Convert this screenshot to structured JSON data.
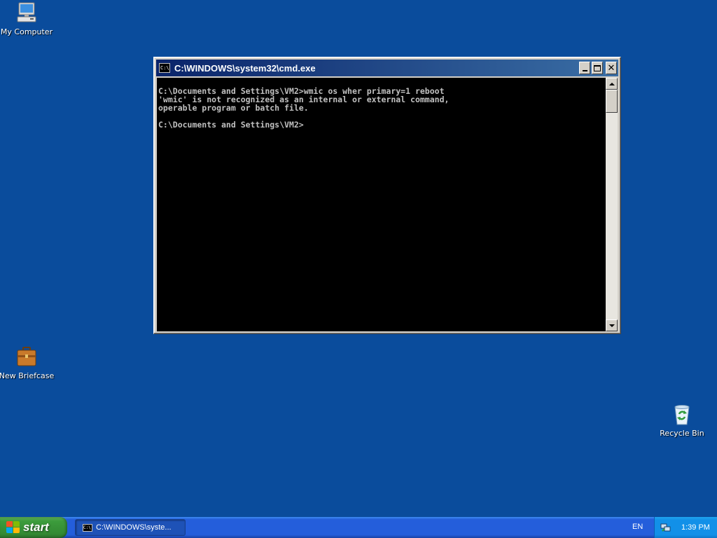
{
  "desktop": {
    "icons": [
      {
        "label": "My Computer",
        "icon": "my-computer-icon"
      },
      {
        "label": "New Briefcase",
        "icon": "briefcase-icon"
      },
      {
        "label": "Recycle Bin",
        "icon": "recycle-bin-icon"
      }
    ]
  },
  "window": {
    "title": "C:\\WINDOWS\\system32\\cmd.exe",
    "icon_text": "C:\\",
    "console_lines": [
      "C:\\Documents and Settings\\VM2>wmic os wher primary=1 reboot",
      "'wmic' is not recognized as an internal or external command,",
      "operable program or batch file.",
      "",
      "C:\\Documents and Settings\\VM2>"
    ]
  },
  "taskbar": {
    "start_label": "start",
    "task_label": "C:\\WINDOWS\\syste...",
    "language": "EN",
    "clock": "1:39 PM"
  },
  "colors": {
    "desktop": "#0a4c9c",
    "titlebar_start": "#0a246a",
    "titlebar_end": "#3a6ea5",
    "console_bg": "#000000",
    "console_fg": "#c0c0c0"
  }
}
